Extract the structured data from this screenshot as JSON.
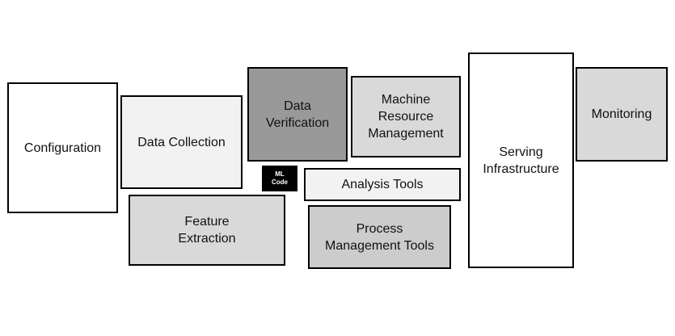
{
  "colors": {
    "white": "#ffffff",
    "light_gray": "#f2f2f2",
    "mid_gray": "#d9d9d9",
    "gray": "#cccccc",
    "dark_gray": "#999999",
    "black": "#000000"
  },
  "boxes": {
    "configuration": "Configuration",
    "data_collection": "Data Collection",
    "data_verification": "Data\nVerification",
    "machine_resource_management": "Machine\nResource\nManagement",
    "monitoring": "Monitoring",
    "serving_infrastructure": "Serving\nInfrastructure",
    "analysis_tools": "Analysis Tools",
    "feature_extraction": "Feature\nExtraction",
    "process_management_tools": "Process\nManagement Tools",
    "ml_code": "ML\nCode"
  }
}
